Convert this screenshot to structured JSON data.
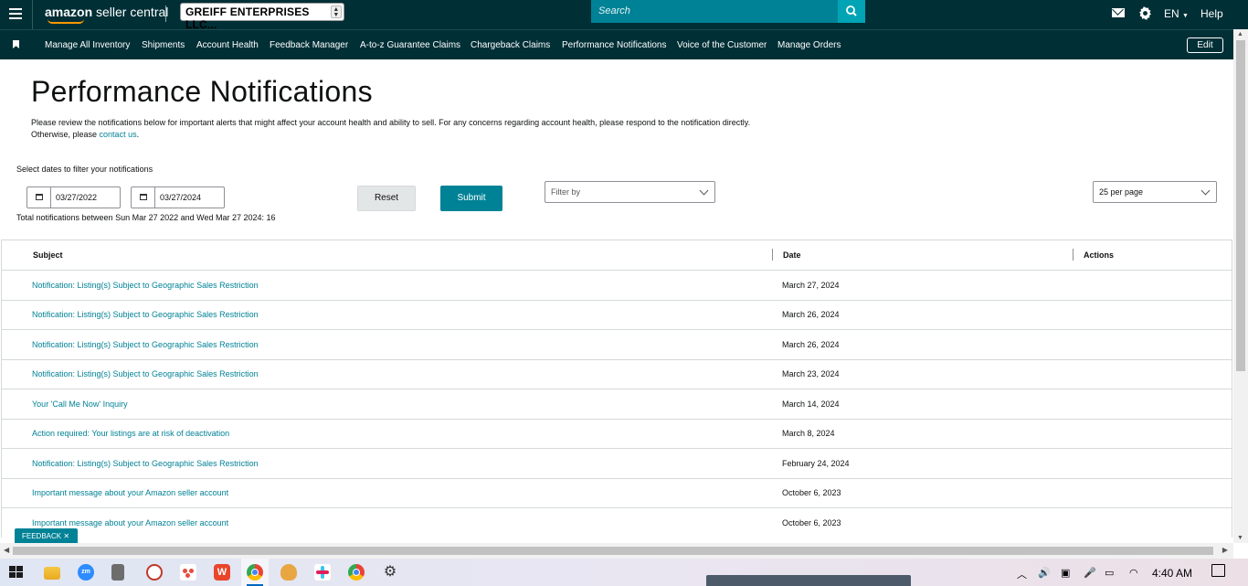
{
  "header": {
    "logo_bold": "amazon",
    "logo_rest": " seller central",
    "account_selector": "GREIFF ENTERPRISES LLC...",
    "search_placeholder": "Search",
    "language": "EN",
    "help": "Help"
  },
  "nav": {
    "items": [
      "Manage All Inventory",
      "Shipments",
      "Account Health",
      "Feedback Manager",
      "A-to-z Guarantee Claims",
      "Chargeback Claims",
      "Performance Notifications",
      "Voice of the Customer",
      "Manage Orders"
    ],
    "edit_label": "Edit"
  },
  "page": {
    "title": "Performance Notifications",
    "description": "Please review the notifications below for important alerts that might affect your account health and ability to sell. For any concerns regarding account health, please respond to the notification directly.",
    "description_line2_prefix": "Otherwise, please ",
    "contact_link": "contact us",
    "description_line2_suffix": "."
  },
  "filters": {
    "label": "Select dates to filter your notifications",
    "start_date": "03/27/2022",
    "end_date": "03/27/2024",
    "reset_label": "Reset",
    "submit_label": "Submit",
    "filter_by_placeholder": "Filter by",
    "per_page": "25 per page",
    "total_text": "Total notifications between Sun Mar 27 2022 and Wed Mar 27 2024: 16"
  },
  "table": {
    "headers": [
      "Subject",
      "Date",
      "Actions"
    ],
    "rows": [
      {
        "subject": "Notification: Listing(s) Subject to Geographic Sales Restriction",
        "date": "March 27, 2024"
      },
      {
        "subject": "Notification: Listing(s) Subject to Geographic Sales Restriction",
        "date": "March 26, 2024"
      },
      {
        "subject": "Notification: Listing(s) Subject to Geographic Sales Restriction",
        "date": "March 26, 2024"
      },
      {
        "subject": "Notification: Listing(s) Subject to Geographic Sales Restriction",
        "date": "March 23, 2024"
      },
      {
        "subject": "Your 'Call Me Now' Inquiry",
        "date": "March 14, 2024"
      },
      {
        "subject": "Action required: Your listings are at risk of deactivation",
        "date": "March 8, 2024"
      },
      {
        "subject": "Notification: Listing(s) Subject to Geographic Sales Restriction",
        "date": "February 24, 2024"
      },
      {
        "subject": "Important message about your Amazon seller account",
        "date": "October 6, 2023"
      },
      {
        "subject": "Important message about your Amazon seller account",
        "date": "October 6, 2023"
      }
    ]
  },
  "feedback_label": "FEEDBACK",
  "taskbar": {
    "time": "4:40 AM"
  },
  "colors": {
    "header_bg": "#002f36",
    "accent": "#008296",
    "search_btn": "#00a4b4"
  }
}
